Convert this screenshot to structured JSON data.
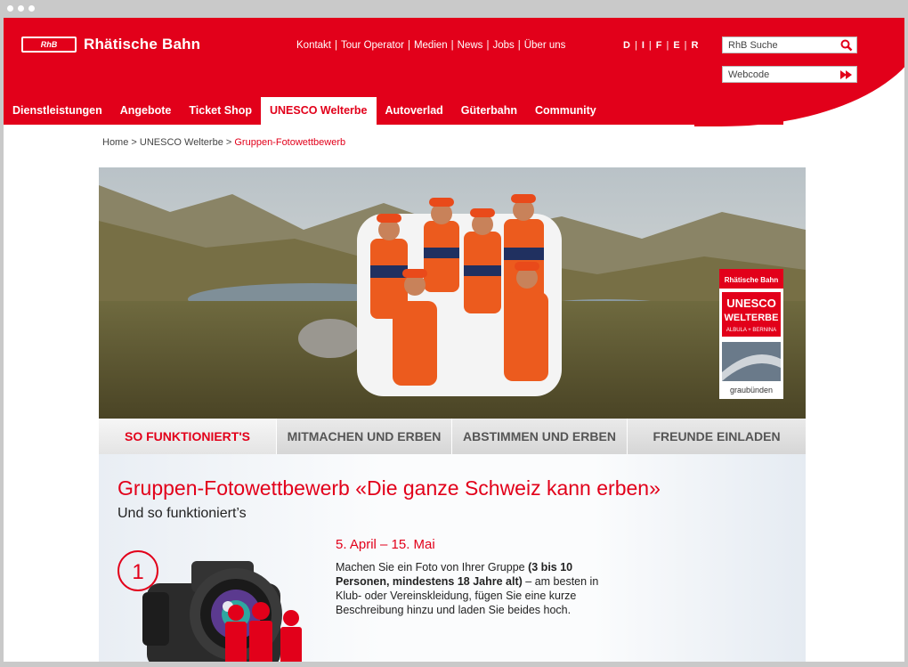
{
  "brand": {
    "logo_mark": "RhB",
    "name": "Rhätische Bahn"
  },
  "topnav": [
    "Kontakt",
    "Tour Operator",
    "Medien",
    "News",
    "Jobs",
    "Über uns"
  ],
  "languages": [
    "D",
    "I",
    "F",
    "E",
    "R"
  ],
  "search": {
    "placeholder": "RhB Suche",
    "icon": "search-icon"
  },
  "webcode": {
    "placeholder": "Webcode",
    "icon": "fast-forward-icon"
  },
  "mainnav": [
    {
      "label": "Dienstleistungen",
      "active": false
    },
    {
      "label": "Angebote",
      "active": false
    },
    {
      "label": "Ticket Shop",
      "active": false
    },
    {
      "label": "UNESCO Welterbe",
      "active": true
    },
    {
      "label": "Autoverlad",
      "active": false
    },
    {
      "label": "Güterbahn",
      "active": false
    },
    {
      "label": "Community",
      "active": false
    }
  ],
  "breadcrumb": {
    "home": "Home",
    "section": "UNESCO Welterbe",
    "current": "Gruppen-Fotowettbewerb"
  },
  "hero_badge": {
    "brand": "Rhätische Bahn",
    "line1": "UNESCO",
    "line2": "WELTERBE",
    "line3": "ALBULA + BERNINA",
    "footer": "graubünden"
  },
  "tabs": [
    {
      "label": "SO FUNKTIONIERT'S",
      "active": true
    },
    {
      "label": "MITMACHEN UND ERBEN",
      "active": false
    },
    {
      "label": "ABSTIMMEN UND ERBEN",
      "active": false
    },
    {
      "label": "FREUNDE EINLADEN",
      "active": false
    }
  ],
  "content": {
    "title": "Gruppen-Fotowettbewerb «Die ganze Schweiz kann erben»",
    "subtitle": "Und so funktioniert’s",
    "step_number": "1",
    "date": "5. April – 15. Mai",
    "desc_pre": "Machen Sie ein Foto von Ihrer Gruppe ",
    "desc_bold": "(3 bis 10 Personen, mindestens 18 Jahre alt)",
    "desc_post": " – am besten in Klub- oder Vereinskleidung, fügen Sie eine kurze Beschreibung hinzu und laden Sie beides hoch."
  },
  "colors": {
    "brand_red": "#e2001a",
    "tab_gray": "#d9d9d9"
  }
}
